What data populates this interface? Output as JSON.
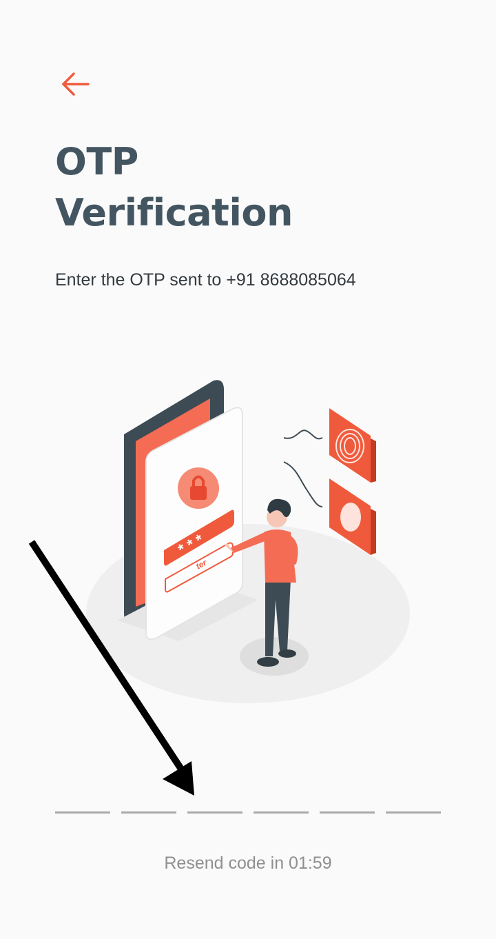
{
  "header": {
    "back_icon": "arrow-left-icon",
    "accent_color": "#f05a3c"
  },
  "title": {
    "line1": "OTP",
    "line2": "Verification"
  },
  "subtitle": "Enter the OTP sent to +91 8688085064",
  "illustration": {
    "field_text": "ter",
    "masked": "* * *"
  },
  "otp": {
    "digits": [
      "",
      "",
      "",
      "",
      "",
      ""
    ]
  },
  "resend": {
    "label": "Resend code in 01:59"
  }
}
